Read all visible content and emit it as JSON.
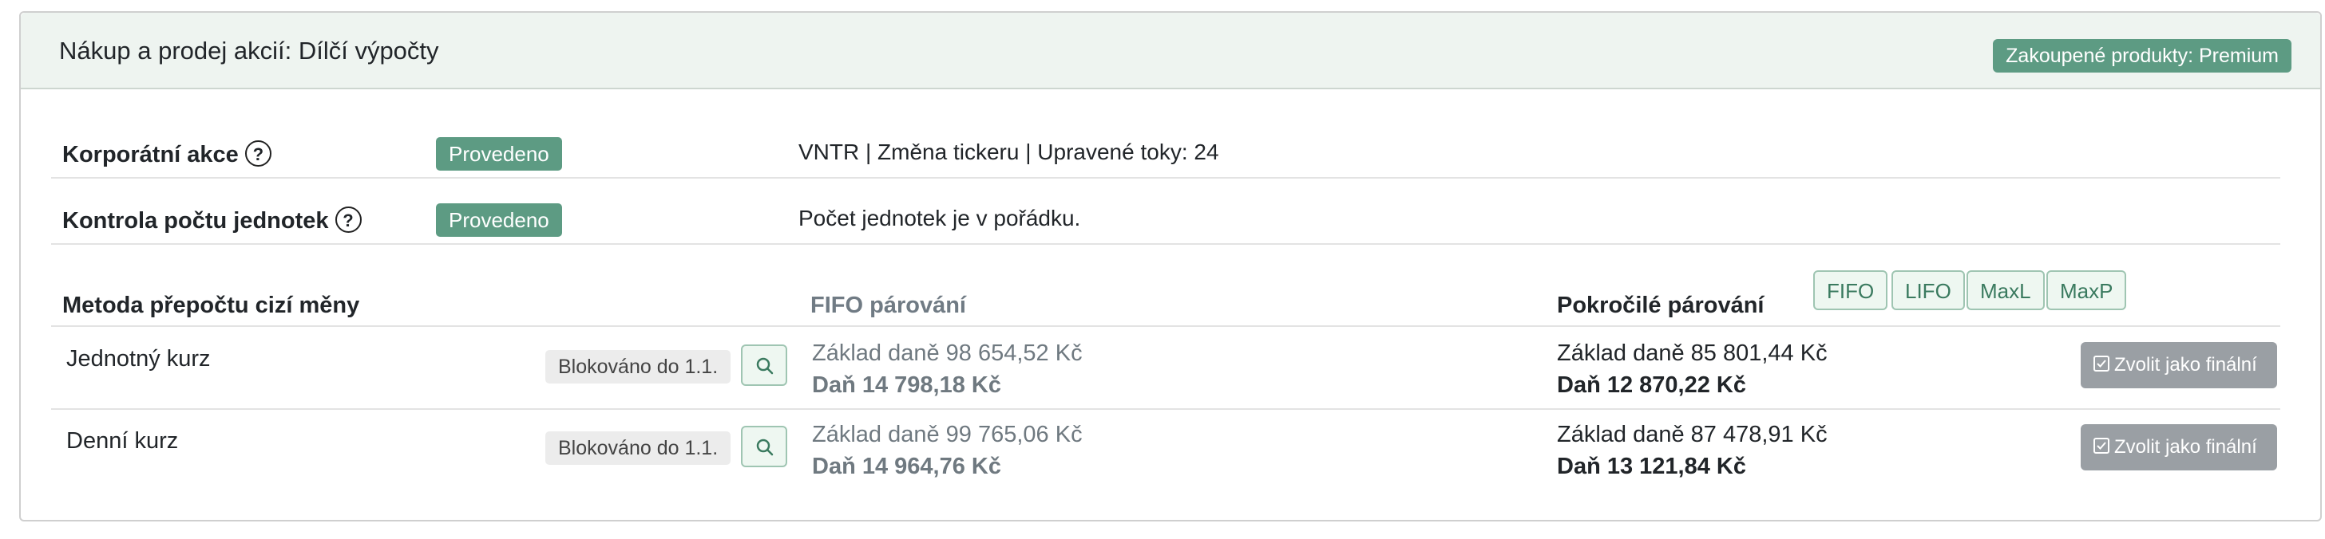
{
  "header": {
    "title": "Nákup a prodej akcií: Dílčí výpočty",
    "premium_badge": "Zakoupené produkty: Premium"
  },
  "checks": [
    {
      "label": "Korporátní akce",
      "help_icon": "?",
      "status": "Provedeno",
      "detail": "VNTR | Změna tickeru | Upravené toky: 24"
    },
    {
      "label": "Kontrola počtu jednotek",
      "help_icon": "?",
      "status": "Provedeno",
      "detail": "Počet jednotek je v pořádku."
    }
  ],
  "columns": {
    "method": "Metoda přepočtu cizí měny",
    "fifo": "FIFO párování",
    "advanced": "Pokročilé párování"
  },
  "pairing_methods": [
    "FIFO",
    "LIFO",
    "MaxL",
    "MaxP"
  ],
  "rows": [
    {
      "method": "Jednotný kurz",
      "blocked": "Blokováno do 1.1.",
      "fifo_base": "Základ daně 98 654,52 Kč",
      "fifo_tax": "Daň 14 798,18 Kč",
      "adv_base": "Základ daně 85 801,44 Kč",
      "adv_tax": "Daň 12 870,22 Kč",
      "final_label": "Zvolit jako finální"
    },
    {
      "method": "Denní kurz",
      "blocked": "Blokováno do 1.1.",
      "fifo_base": "Základ daně 99 765,06 Kč",
      "fifo_tax": "Daň 14 964,76 Kč",
      "adv_base": "Základ daně 87 478,91 Kč",
      "adv_tax": "Daň 13 121,84 Kč",
      "final_label": "Zvolit jako finální"
    }
  ],
  "icons": {
    "search": "search-icon",
    "help": "question-circle-icon",
    "checkbox": "checkbox-checked-icon"
  },
  "colors": {
    "accent": "#5d9b83",
    "header_bg": "#eef4f0",
    "disabled_button": "#9a9fa4"
  }
}
